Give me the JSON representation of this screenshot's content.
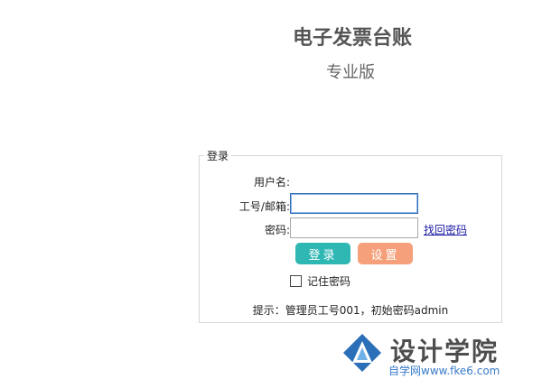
{
  "header": {
    "title": "电子发票台账",
    "subtitle": "专业版"
  },
  "login": {
    "legend": "登录",
    "username_label": "用户名:",
    "employee_label": "工号/邮箱:",
    "employee_value": "",
    "password_label": "密码:",
    "password_value": "",
    "forgot_link": "找回密码",
    "login_button": "登录",
    "settings_button": "设置",
    "remember_label": "记住密码",
    "hint": "提示：管理员工号001，初始密码admin"
  },
  "colors": {
    "login_button": "#2fb7b4",
    "settings_button": "#f5a07a"
  },
  "watermark": {
    "text": "设计学院",
    "sub": "自学网www.fke6.com"
  }
}
